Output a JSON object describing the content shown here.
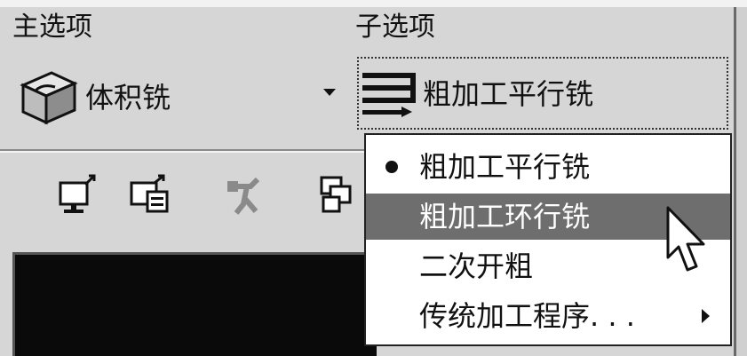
{
  "labels": {
    "main_options": "主选项",
    "sub_options": "子选项"
  },
  "main_select": {
    "value": "体积铣",
    "icon": "cube-icon"
  },
  "sub_select": {
    "value": "粗加工平行铣",
    "icon": "parallel-lines-icon"
  },
  "toolbar": {
    "buttons": [
      {
        "icon": "monitor-export-icon"
      },
      {
        "icon": "monitor-list-icon"
      },
      {
        "icon": "figure-disabled-icon"
      },
      {
        "icon": "layers-icon"
      }
    ]
  },
  "dropdown": {
    "items": [
      {
        "label": "粗加工平行铣",
        "selected": true
      },
      {
        "label": "粗加工环行铣",
        "highlighted": true
      },
      {
        "label": "二次开粗"
      },
      {
        "label": "传统加工程序. . .",
        "has_submenu": true
      }
    ]
  },
  "colors": {
    "background": "#d6d6d6",
    "highlight": "#6e6e6e",
    "viewport": "#0a0a0a"
  }
}
